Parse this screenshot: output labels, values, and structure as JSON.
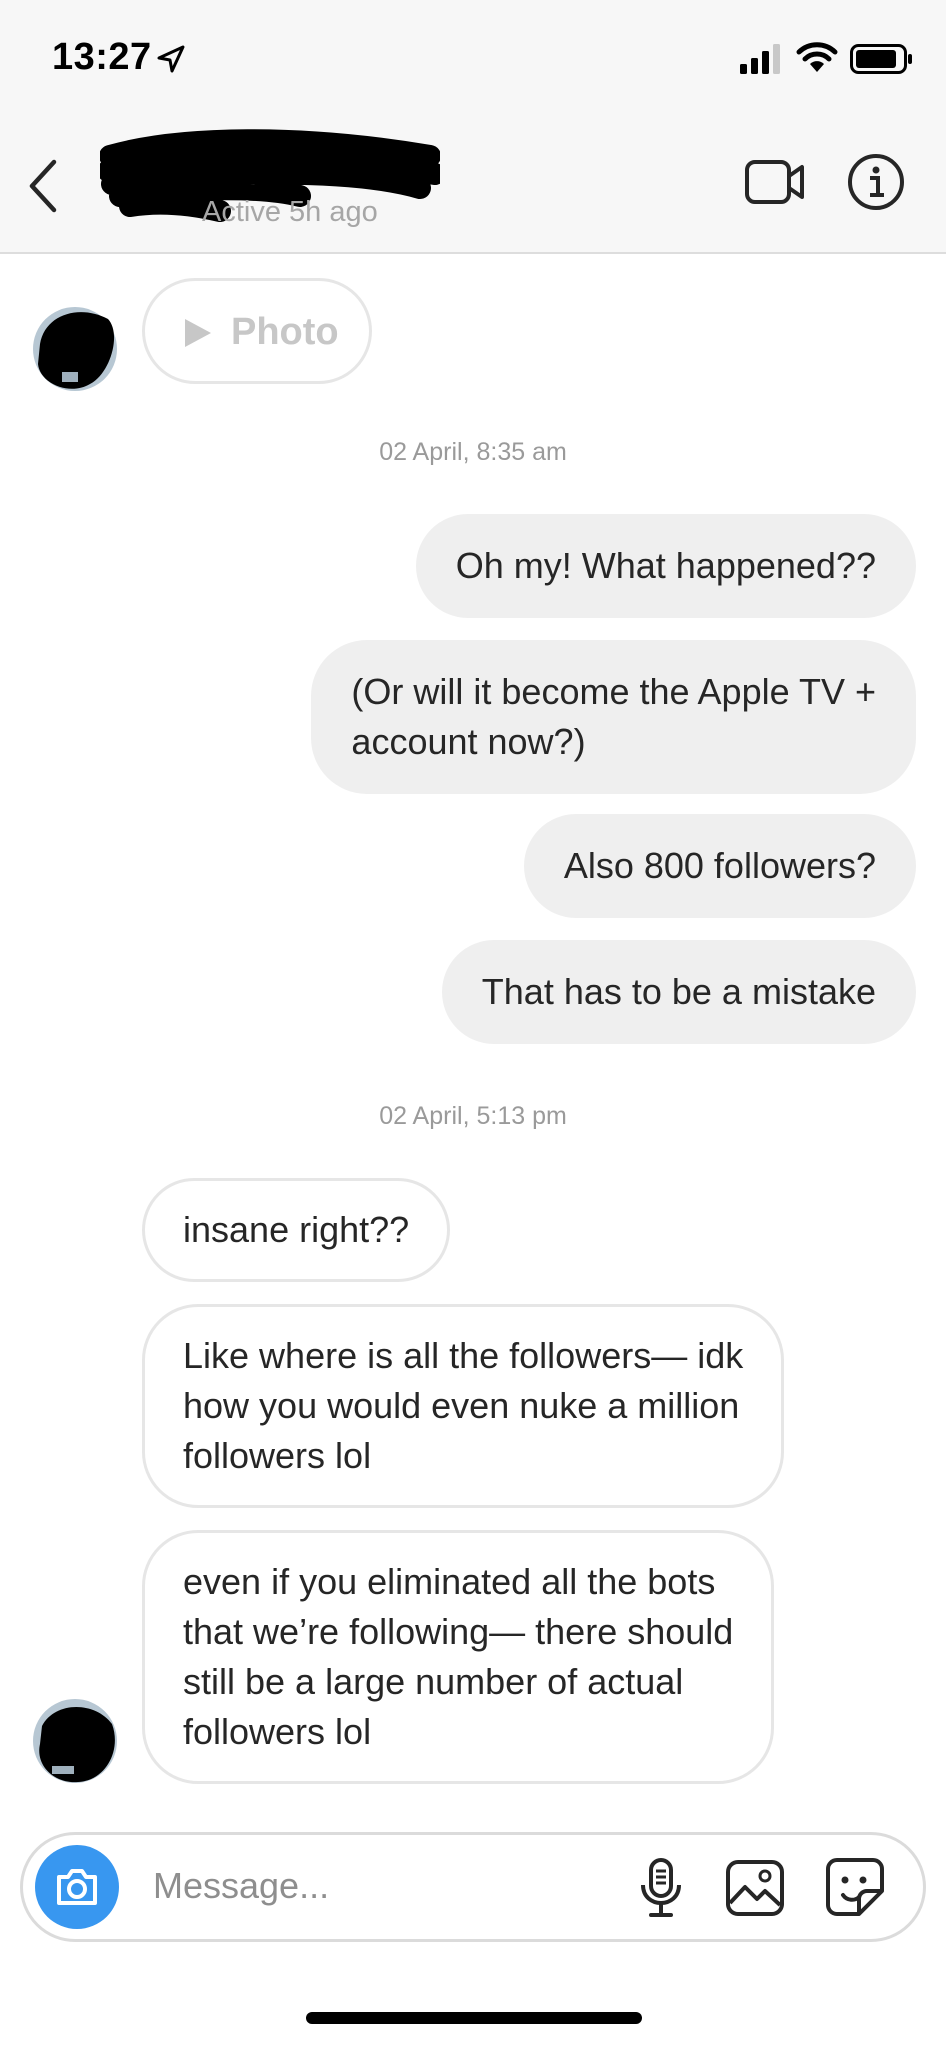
{
  "status_bar": {
    "time": "13:27"
  },
  "header": {
    "active_text": "Active 5h ago"
  },
  "thread": {
    "photo_label": "Photo",
    "timestamp_1": "02 April, 8:35 am",
    "outgoing": [
      {
        "lines": [
          "Oh my! What happened??"
        ]
      },
      {
        "lines": [
          "(Or will it become the Apple TV +",
          "account now?)"
        ]
      },
      {
        "lines": [
          "Also 800 followers?"
        ]
      },
      {
        "lines": [
          "That has to be a mistake"
        ]
      }
    ],
    "timestamp_2": "02 April, 5:13 pm",
    "incoming": [
      {
        "lines": [
          "insane right??"
        ]
      },
      {
        "lines": [
          "Like where is all the followers— idk",
          "how you would even nuke a million",
          "followers lol"
        ]
      },
      {
        "lines": [
          "even if you eliminated all the bots",
          "that we’re following— there should",
          "still be a large number of actual",
          "followers lol"
        ]
      }
    ]
  },
  "composer": {
    "placeholder": "Message..."
  },
  "icons": {
    "back": "chevron-left-icon",
    "video": "video-camera-icon",
    "info": "info-icon",
    "camera": "camera-icon",
    "mic": "microphone-icon",
    "gallery": "image-icon",
    "sticker": "sticker-icon"
  },
  "colors": {
    "accent": "#3897f0",
    "outgoing_bubble": "#efefef",
    "header_bg": "#f7f7f7"
  }
}
